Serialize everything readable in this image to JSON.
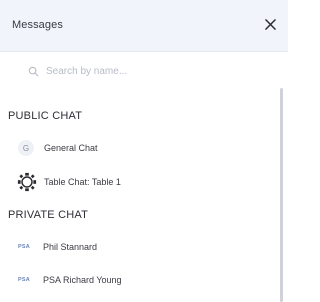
{
  "header": {
    "title": "Messages",
    "close_icon": "close-icon"
  },
  "search": {
    "placeholder": "Search by name...",
    "value": "",
    "icon": "search-icon"
  },
  "public_chat": {
    "title": "PUBLIC CHAT",
    "items": [
      {
        "avatar_letter": "G",
        "label": "General Chat"
      },
      {
        "icon": "table-icon",
        "label": "Table Chat: Table 1"
      }
    ]
  },
  "private_chat": {
    "title": "PRIVATE CHAT",
    "items": [
      {
        "badge": "PSA",
        "label": "Phil Stannard"
      },
      {
        "badge": "PSA",
        "label": "PSA Richard Young"
      }
    ]
  },
  "colors": {
    "header_bg": "#f1f5fb",
    "text": "#2b2b33",
    "badge": "#6d86b8",
    "scrollbar": "#cfd3d9"
  }
}
